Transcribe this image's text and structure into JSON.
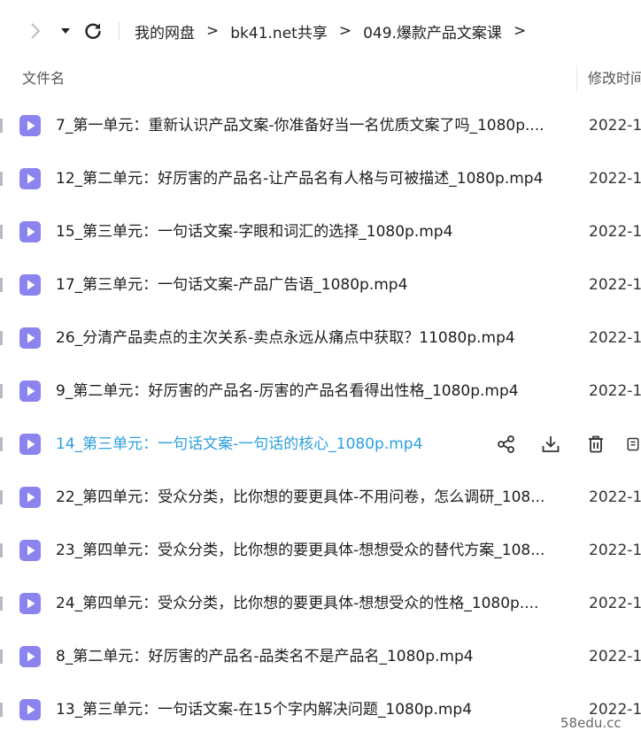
{
  "breadcrumb": {
    "items": [
      "我的网盘",
      "bk41.net共享",
      "049.爆款产品文案课"
    ],
    "separator": ">"
  },
  "header": {
    "name_col": "文件名",
    "time_col": "修改时间"
  },
  "files": [
    {
      "name": "7_第一单元：重新认识产品文案-你准备好当一名优质文案了吗_1080p....",
      "time": "2022-1"
    },
    {
      "name": "12_第二单元：好厉害的产品名-让产品名有人格与可被描述_1080p.mp4",
      "time": "2022-1"
    },
    {
      "name": "15_第三单元：一句话文案-字眼和词汇的选择_1080p.mp4",
      "time": "2022-1"
    },
    {
      "name": "17_第三单元：一句话文案-产品广告语_1080p.mp4",
      "time": "2022-1"
    },
    {
      "name": "26_分清产品卖点的主次关系-卖点永远从痛点中获取？11080p.mp4",
      "time": "2022-1"
    },
    {
      "name": "9_第二单元：好厉害的产品名-厉害的产品名看得出性格_1080p.mp4",
      "time": "2022-1"
    },
    {
      "name": "14_第三单元：一句话文案-一句话的核心_1080p.mp4",
      "time": ""
    },
    {
      "name": "22_第四单元：受众分类，比你想的要更具体-不用问卷，怎么调研_108...",
      "time": "2022-1"
    },
    {
      "name": "23_第四单元：受众分类，比你想的要更具体-想想受众的替代方案_108...",
      "time": "2022-1"
    },
    {
      "name": "24_第四单元：受众分类，比你想的要更具体-想想受众的性格_1080p....",
      "time": "2022-1"
    },
    {
      "name": "8_第二单元：好厉害的产品名-品类名不是产品名_1080p.mp4",
      "time": "2022-1"
    },
    {
      "name": "13_第三单元：一句话文案-在15个字内解决问题_1080p.mp4",
      "time": "2022-1"
    }
  ],
  "watermark": "58edu.cc",
  "colors": {
    "accent": "#2c9fe0",
    "video_icon": "#8b83ee"
  },
  "icons": {
    "nav": [
      "chevron-right-icon",
      "caret-down-icon",
      "refresh-icon"
    ],
    "file": "video-file-icon",
    "row_actions": [
      "share-icon",
      "download-icon",
      "delete-icon",
      "more-icon"
    ]
  }
}
